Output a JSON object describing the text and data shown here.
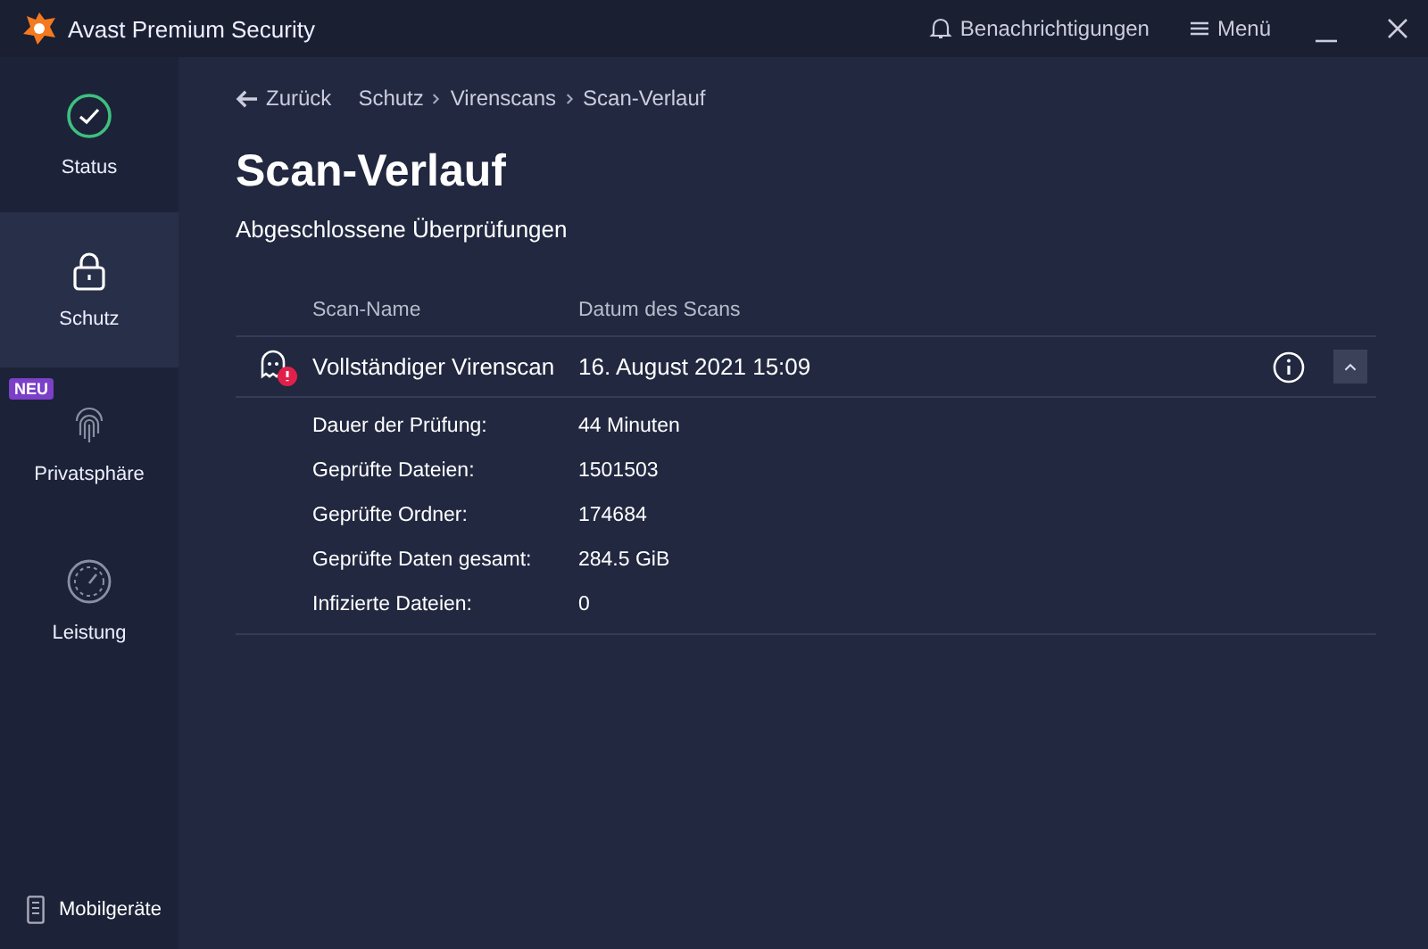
{
  "window": {
    "title": "Avast Premium Security",
    "actions": [
      {
        "kind": "bell",
        "label": "Benachrichtigungen"
      },
      {
        "kind": "menu",
        "label": "Menü"
      }
    ]
  },
  "sidebar": {
    "items": [
      {
        "kind": "status",
        "label": "Status",
        "selected": false
      },
      {
        "kind": "lock",
        "label": "Schutz",
        "selected": true
      },
      {
        "kind": "fingerprint",
        "label": "Privatsphäre",
        "selected": false,
        "badge": "NEU"
      },
      {
        "kind": "gauge",
        "label": "Leistung",
        "selected": false
      }
    ],
    "footer": "Mobilgeräte"
  },
  "breadcrumb": {
    "back": "Zurück",
    "path": [
      "Schutz",
      "Virenscans",
      "Scan-Verlauf"
    ]
  },
  "title": "Scan-Verlauf",
  "subtitle": "Abgeschlossene Überprüfungen",
  "table": {
    "columns": [
      "Scan-Name",
      "Datum des Scans"
    ],
    "rows": [
      {
        "name": "Vollständiger Virenscan",
        "date": "16. August 2021 15:09",
        "alert": true,
        "expanded": true,
        "details": [
          {
            "label": "Dauer der Prüfung:",
            "value": "44 Minuten"
          },
          {
            "label": "Geprüfte Dateien:",
            "value": "1501503"
          },
          {
            "label": "Geprüfte Ordner:",
            "value": "174684"
          },
          {
            "label": "Geprüfte Daten gesamt:",
            "value": "284.5 GiB"
          },
          {
            "label": "Infizierte Dateien:",
            "value": "0"
          }
        ]
      }
    ]
  }
}
